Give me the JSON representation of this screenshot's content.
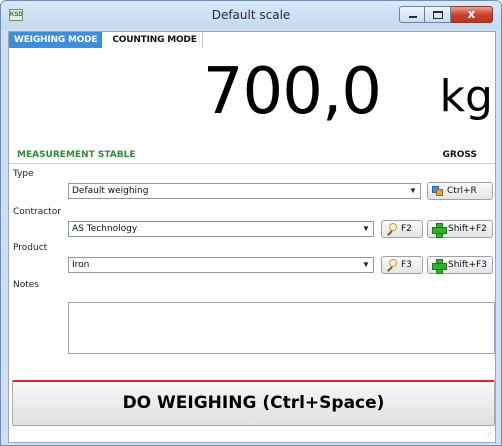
{
  "window": {
    "title": "Default scale",
    "app_icon_text": "KSD",
    "close_glyph": "x"
  },
  "tabs": [
    {
      "label": "WEIGHING MODE",
      "active": true
    },
    {
      "label": "COUNTING MODE",
      "active": false
    }
  ],
  "display": {
    "weight": "700,0",
    "unit": "kg"
  },
  "status": {
    "stability": "MEASUREMENT STABLE",
    "mode": "GROSS",
    "stability_color": "#2f8a34"
  },
  "form": {
    "type": {
      "label": "Type",
      "value": "Default weighing",
      "button_label": "Ctrl+R",
      "button_icon": "weighing-type-icon"
    },
    "contractor": {
      "label": "Contractor",
      "value": "AS Technology",
      "search_label": "F2",
      "add_label": "Shift+F2"
    },
    "product": {
      "label": "Product",
      "value": "Iron",
      "search_label": "F3",
      "add_label": "Shift+F3"
    },
    "notes": {
      "label": "Notes",
      "value": ""
    }
  },
  "actions": {
    "weigh_label": "DO WEIGHING (Ctrl+Space)",
    "weigh_accent": "#d8271d"
  },
  "colors": {
    "active_tab": "#3c8fdd"
  }
}
